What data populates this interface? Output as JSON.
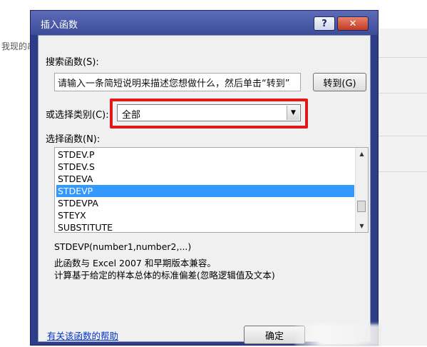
{
  "background": {
    "left_text": "我现的串"
  },
  "dialog": {
    "title": "插入函数",
    "help_label": "?",
    "close_label": "✕",
    "search_label": "搜索函数(S):",
    "search_description": "请输入一条简短说明来描述您想做什么，然后单击“转到”",
    "goto_label": "转到(G)",
    "category_label": "或选择类别(C):",
    "category_value": "全部",
    "function_list_label": "选择函数(N):",
    "functions": [
      "STDEV.P",
      "STDEV.S",
      "STDEVA",
      "STDEVP",
      "STDEVPA",
      "STEYX",
      "SUBSTITUTE"
    ],
    "selected_function": "STDEVP",
    "syntax": "STDEVP(number1,number2,...)",
    "description_line1": "此函数与 Excel 2007 和早期版本兼容。",
    "description_line2": "计算基于给定的样本总体的标准偏差(忽略逻辑值及文本)",
    "help_link": "有关该函数的帮助",
    "ok_label": "确定"
  },
  "colors": {
    "highlight_border": "#e01818",
    "selection": "#3399ff",
    "titlebar": "#3d4c99",
    "link": "#0033cc"
  }
}
